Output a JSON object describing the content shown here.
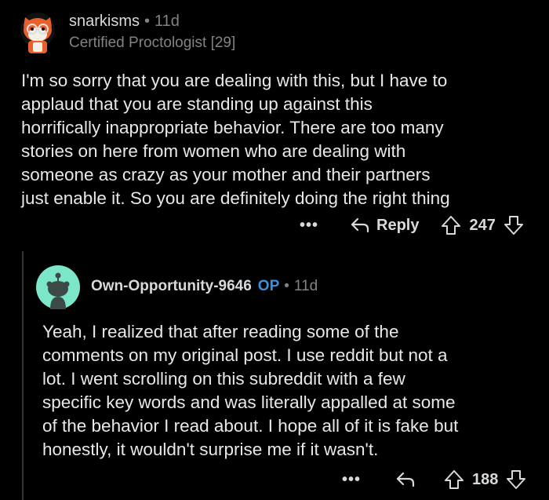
{
  "comment": {
    "username": "snarkisms",
    "separator": "•",
    "time": "11d",
    "flair": "Certified Proctologist [29]",
    "body_lines": [
      "I'm so sorry that you are dealing with this, but I have to",
      "applaud that you are standing up against this",
      "horrifically inappropriate behavior. There are too many",
      "stories on here from women who are dealing with",
      "someone as crazy as your mother and their partners",
      "just enable it. So you are definitely doing the right thing"
    ],
    "more_label": "•••",
    "reply_label": "Reply",
    "score": "247"
  },
  "reply": {
    "username": "Own-Opportunity-9646",
    "op_badge": "OP",
    "separator": "•",
    "time": "11d",
    "body_lines": [
      "Yeah, I realized that after reading some of the",
      "comments on my original post. I use reddit but not a",
      "lot. I went scrolling on this subreddit with a few",
      "specific key words and was literally appalled at some",
      "of the behavior I read about. I hope all of it is fake but",
      "honestly, it wouldn't surprise me if it wasn't."
    ],
    "more_label": "•••",
    "score": "188"
  },
  "colors": {
    "background": "#000000",
    "text": "#d7dadc",
    "muted": "#818384",
    "op_blue": "#3d8fdc",
    "avatar_teal": "#7ce6c9"
  }
}
